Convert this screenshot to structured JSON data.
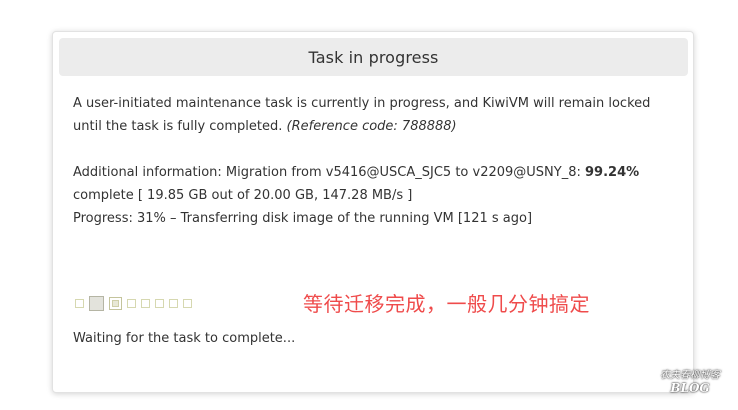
{
  "panel": {
    "title": "Task in progress",
    "message_main": "A user-initiated maintenance task is currently in progress, and KiwiVM will remain locked until the task is fully completed.",
    "reference": "(Reference code: 788888)",
    "additional_prefix": "Additional information: Migration from v5416@USCA_SJC5 to v2209@USNY_8:",
    "percent": "99.24%",
    "additional_suffix": "complete [ 19.85 GB out of 20.00 GB, 147.28 MB/s ]",
    "progress_line": "Progress: 31% – Transferring disk image of the running VM [121 s ago]",
    "waiting": "Waiting for the task to complete..."
  },
  "annotation": "等待迁移完成，一般几分钟搞定",
  "watermark": {
    "line1": "农夫春柳博客",
    "line2": "BLOG"
  },
  "colors": {
    "annotation": "#ef4b4b",
    "header_bg": "#ececec",
    "text": "#333333"
  }
}
